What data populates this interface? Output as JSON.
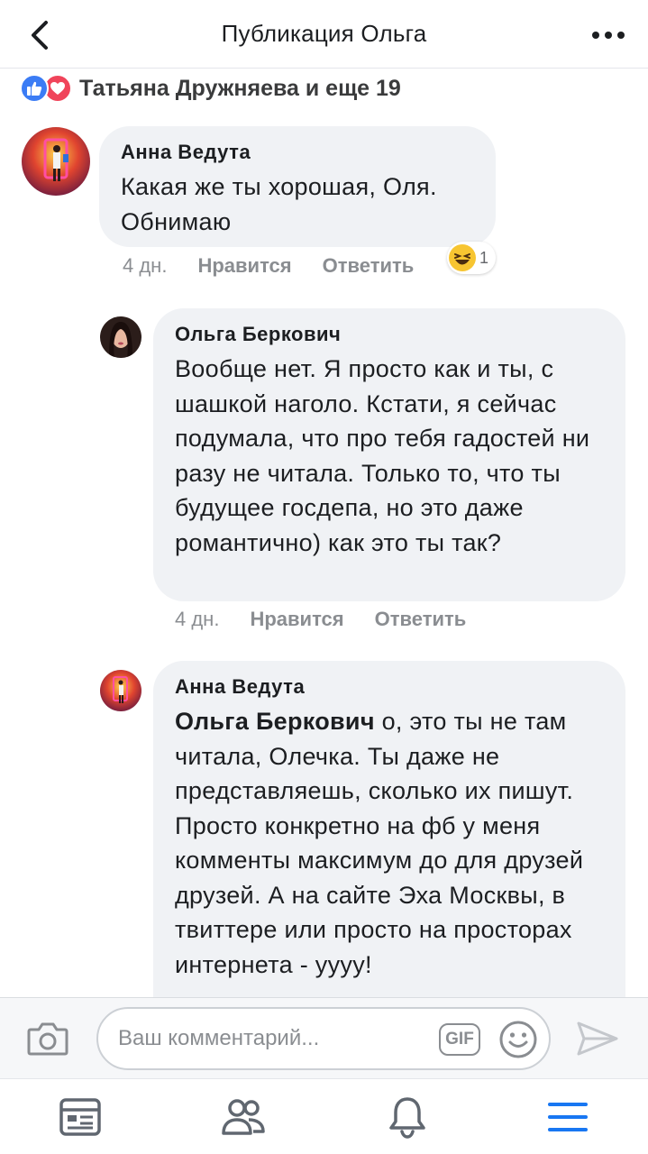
{
  "header": {
    "title": "Публикация Ольга",
    "back_icon": "chevron-left-icon",
    "more_icon": "more-dots-icon"
  },
  "reactions": {
    "icons": [
      "like-icon",
      "love-icon"
    ],
    "summary": "Татьяна Дружняева и еще 19"
  },
  "comments": [
    {
      "author": "Анна Ведута",
      "text": "Какая же ты хорошая, Оля. Обнимаю",
      "time": "4 дн.",
      "like_label": "Нравится",
      "reply_label": "Ответить",
      "reaction": {
        "icon": "haha-emoji-icon",
        "count": "1"
      }
    },
    {
      "author": "Ольга Беркович",
      "text": "Вообще нет. Я просто как и ты, с шашкой наголо. Кстати, я сейчас подумала, что про тебя гадостей ни разу не читала. Только то, что ты будущее госдепа, но это даже романтично) как это ты так?",
      "time": "4 дн.",
      "like_label": "Нравится",
      "reply_label": "Ответить"
    },
    {
      "author": "Анна Ведута",
      "mention": "Ольга Беркович",
      "text": " о, это ты не там читала, Олечка. Ты даже не представляешь, сколько их пишут. Просто конкретно на фб у меня комменты максимум до для друзей друзей. А на сайте Эха Москвы, в твиттере или просто на просторах интернета - уууу!"
    }
  ],
  "composer": {
    "placeholder": "Ваш комментарий...",
    "gif_label": "GIF",
    "camera_icon": "camera-icon",
    "emoji_icon": "smiley-icon",
    "send_icon": "send-icon"
  },
  "tabbar": {
    "items": [
      "news-feed-icon",
      "friends-icon",
      "notifications-icon",
      "menu-icon"
    ],
    "active_color": "#1877f2",
    "inactive_color": "#606770"
  }
}
